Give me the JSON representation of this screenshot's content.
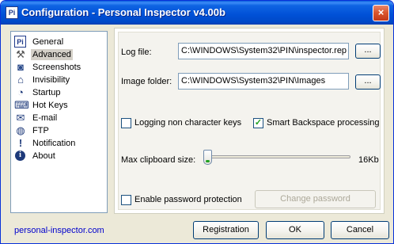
{
  "window": {
    "title": "Configuration - Personal Inspector v4.00b",
    "app_icon_glyph": "Pi",
    "close_glyph": "×"
  },
  "nav": {
    "selected": "Advanced",
    "items": [
      {
        "label": "General",
        "icon": "pi-icon",
        "glyph": "Pi"
      },
      {
        "label": "Advanced",
        "icon": "tools-icon",
        "glyph": "⚒"
      },
      {
        "label": "Screenshots",
        "icon": "camera-icon",
        "glyph": "◙"
      },
      {
        "label": "Invisibility",
        "icon": "hat-icon",
        "glyph": "⌂"
      },
      {
        "label": "Startup",
        "icon": "startup-icon",
        "glyph": "◔"
      },
      {
        "label": "Hot Keys",
        "icon": "keyboard-icon",
        "glyph": "⌨"
      },
      {
        "label": "E-mail",
        "icon": "envelope-icon",
        "glyph": "✉"
      },
      {
        "label": "FTP",
        "icon": "globe-icon",
        "glyph": "◍"
      },
      {
        "label": "Notification",
        "icon": "notification-icon",
        "glyph": "!"
      },
      {
        "label": "About",
        "icon": "info-icon",
        "glyph": "i"
      }
    ]
  },
  "advanced": {
    "log_file_label": "Log file:",
    "log_file_value": "C:\\WINDOWS\\System32\\PIN\\inspector.rep",
    "image_folder_label": "Image folder:",
    "image_folder_value": "C:\\WINDOWS\\System32\\PIN\\Images",
    "browse_label": "...",
    "logging_non_char_label": "Logging non character keys",
    "logging_non_char_checked": false,
    "smart_backspace_label": "Smart Backspace processing",
    "smart_backspace_checked": true,
    "max_clipboard_label": "Max clipboard size:",
    "max_clipboard_value": "16Kb",
    "max_clipboard_level": 0.0,
    "enable_password_label": "Enable password protection",
    "enable_password_checked": false,
    "change_password_label": "Change password"
  },
  "footer": {
    "link": "personal-inspector.com",
    "registration_label": "Registration",
    "ok_label": "OK",
    "cancel_label": "Cancel"
  },
  "colors": {
    "title_bar": "#0050d6",
    "dialog_bg": "#ece9d8",
    "link": "#0000cc",
    "check_mark": "#21a121"
  }
}
